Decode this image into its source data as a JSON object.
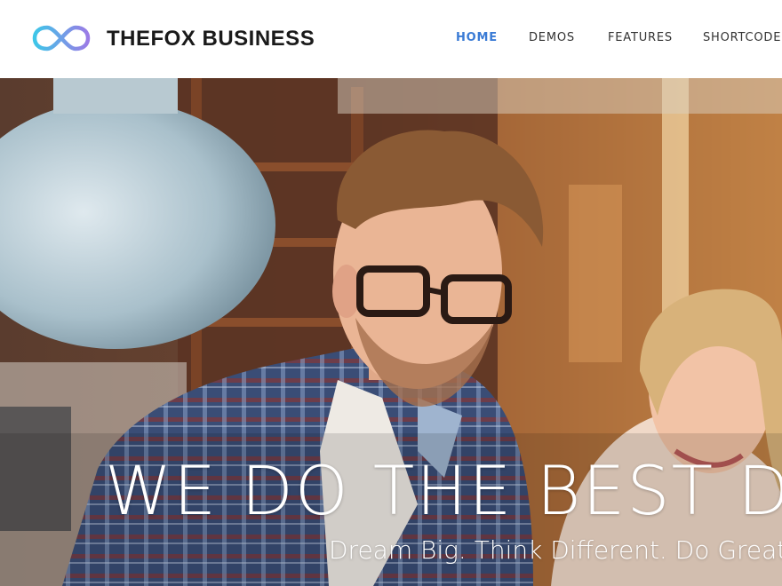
{
  "header": {
    "brand": "THEFOX BUSINESS",
    "logo_icon": "infinity-logo",
    "nav": [
      {
        "label": "HOME",
        "active": true
      },
      {
        "label": "DEMOS",
        "active": false
      },
      {
        "label": "FEATURES",
        "active": false
      },
      {
        "label": "SHORTCODES",
        "active": false
      }
    ]
  },
  "hero": {
    "headline": "WE DO THE BEST D",
    "subline": "Dream Big. Think Different. Do Great"
  },
  "colors": {
    "accent": "#3a7bd5",
    "logo_gradient_start": "#3ec6e8",
    "logo_gradient_end": "#9b7be6",
    "header_bg": "#ffffff",
    "brand_text": "#1a1a1a"
  }
}
